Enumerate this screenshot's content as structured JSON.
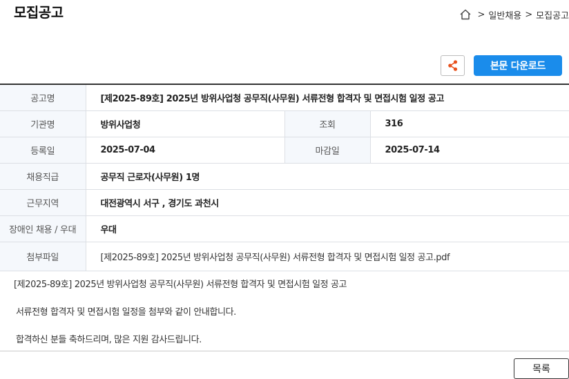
{
  "page": {
    "title": "모집공고"
  },
  "breadcrumb": {
    "sep": ">",
    "items": [
      "일반채용",
      "모집공고"
    ]
  },
  "actions": {
    "download_label": "본문 다운로드",
    "share_icon": "share-icon",
    "accent": "#1a8ceb"
  },
  "info": {
    "title_label": "공고명",
    "title_value": "[제2025-89호] 2025년 방위사업청 공무직(사무원) 서류전형 합격자 및 면접시험 일정 공고",
    "agency_label": "기관명",
    "agency_value": "방위사업청",
    "views_label": "조회",
    "views_value": "316",
    "reg_label": "등록일",
    "reg_value": "2025-07-04",
    "deadline_label": "마감일",
    "deadline_value": "2025-07-14",
    "grade_label": "채용직급",
    "grade_value": "공무직 근로자(사무원) 1명",
    "region_label": "근무지역",
    "region_value": "대전광역시 서구 , 경기도 과천시",
    "disabled_label": "장애인 채용 / 우대",
    "disabled_value": "우대",
    "file_label": "첨부파일",
    "file_value": "[제2025-89호] 2025년 방위사업청 공무직(사무원) 서류전형 합격자 및 면접시험 일정 공고.pdf"
  },
  "body": {
    "line1": "[제2025-89호] 2025년 방위사업청 공무직(사무원) 서류전형 합격자 및 면접시험 일정 공고",
    "line2": "서류전형 합격자 및 면접시험 일정을 첨부와 같이 안내합니다.",
    "line3": "합격하신 분들 축하드리며, 많은 지원 감사드립니다."
  },
  "footer": {
    "list_label": "목록"
  }
}
